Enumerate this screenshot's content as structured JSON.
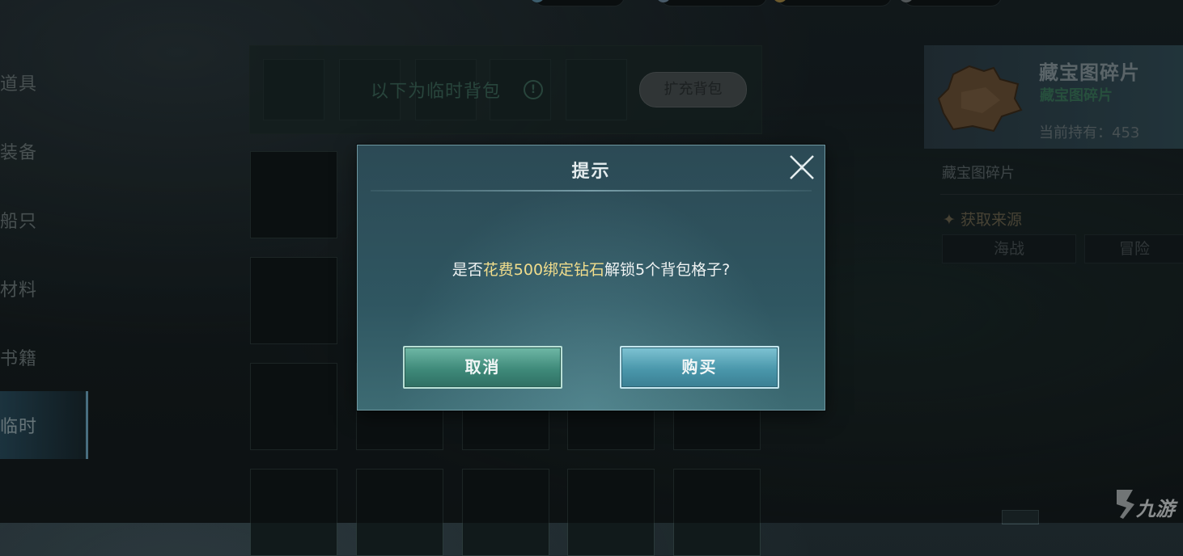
{
  "tabs": [
    {
      "label": "道具"
    },
    {
      "label": "装备"
    },
    {
      "label": "船只"
    },
    {
      "label": "材料"
    },
    {
      "label": "书籍"
    },
    {
      "label": "临时",
      "active": true
    }
  ],
  "bag": {
    "title": "以下为临时背包",
    "info_icon": "!",
    "expand_label": "扩充背包"
  },
  "item": {
    "name": "藏宝图碎片",
    "subtitle": "藏宝图碎片",
    "owned_label": "当前持有：453",
    "description": "藏宝图碎片",
    "source_title": "✦ 获取来源",
    "sources": [
      "海战",
      "冒险"
    ]
  },
  "dialog": {
    "title": "提示",
    "msg_prefix": "是否",
    "msg_highlight": "花费500绑定钻石",
    "msg_suffix": "解锁5个背包格子?",
    "cancel_label": "取消",
    "buy_label": "购买"
  },
  "watermark": "九游",
  "colors": {
    "highlight": "#f1dd8c",
    "cancel_button": "#3f8a7a",
    "buy_button": "#4a97ab",
    "item_subtitle": "#3c7a5f"
  }
}
